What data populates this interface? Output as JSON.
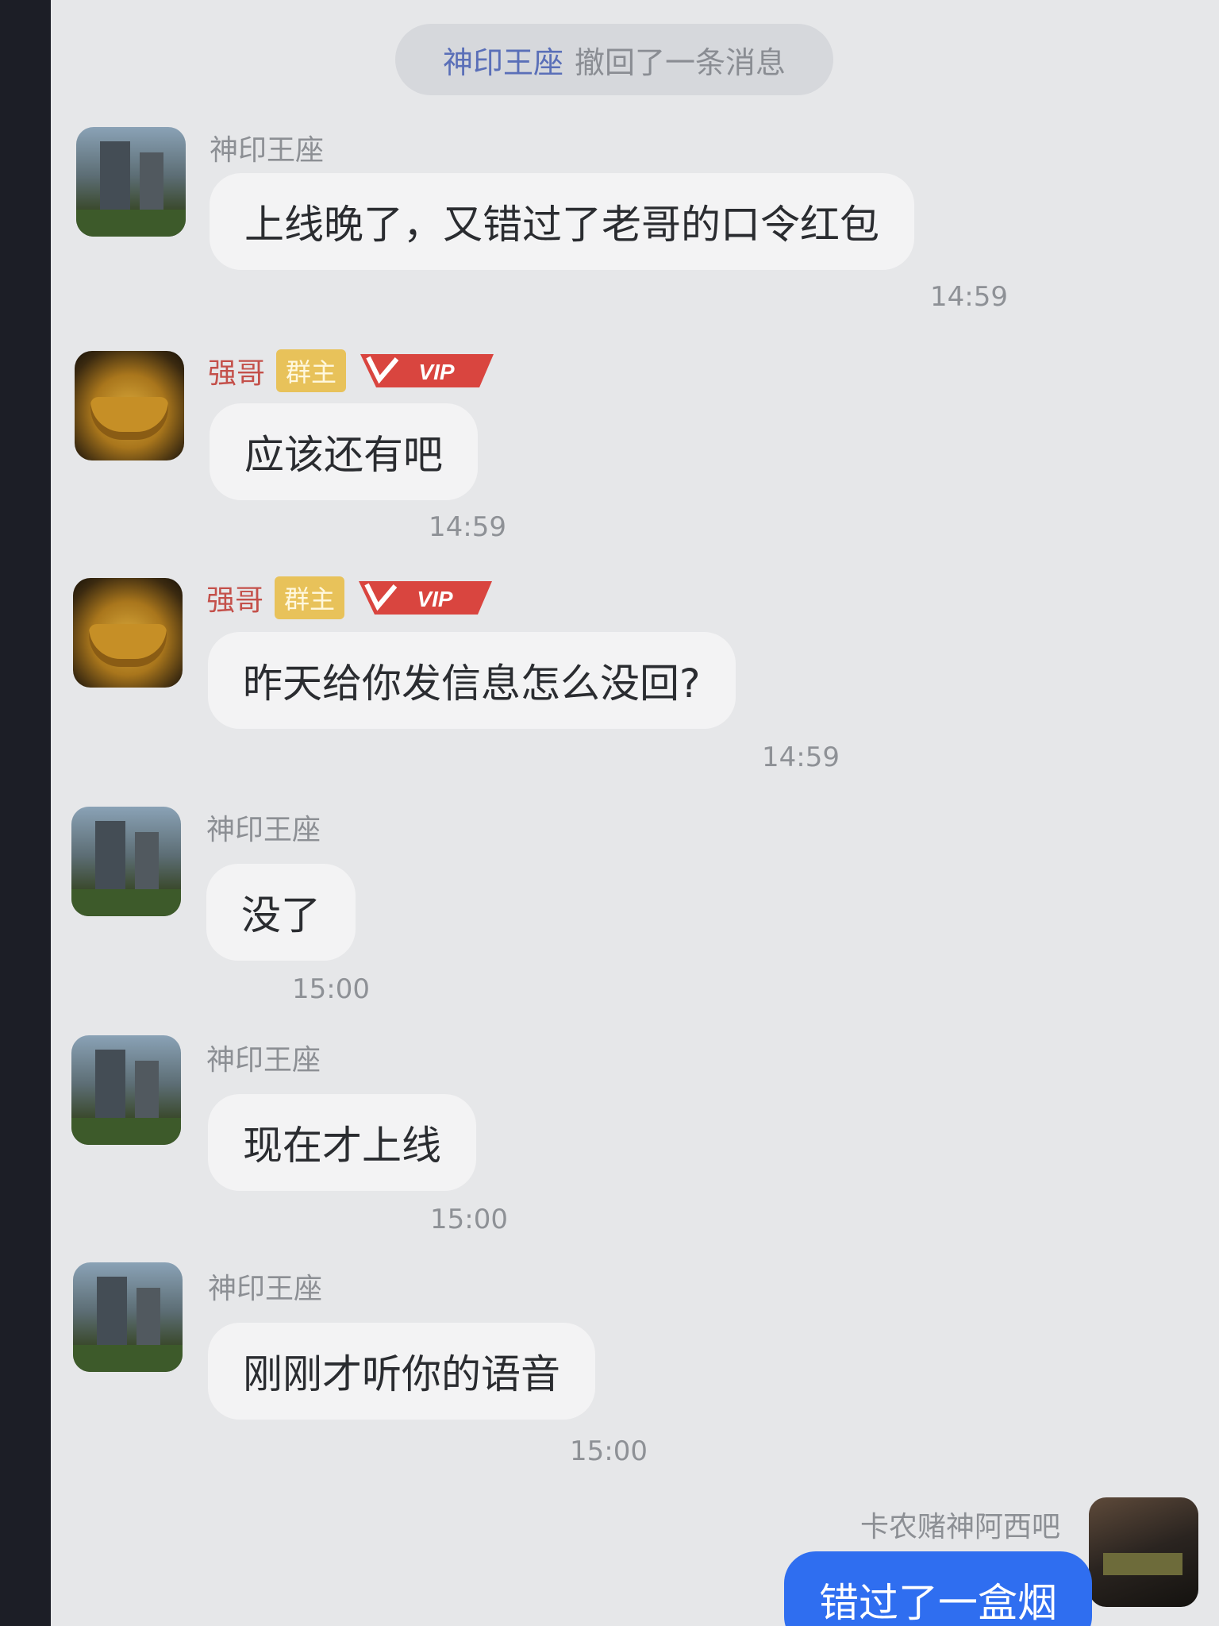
{
  "system_notice": {
    "actor": "神印王座",
    "text": "撤回了一条消息"
  },
  "badges": {
    "owner": "群主",
    "vip": "VIP"
  },
  "messages": [
    {
      "sender": "神印王座",
      "avatar": "building-avatar",
      "text": "上线晚了，又错过了老哥的口令红包",
      "time": "14:59"
    },
    {
      "sender": "强哥",
      "avatar": "treasure-pot-avatar",
      "is_owner": true,
      "is_vip": true,
      "text": "应该还有吧",
      "time": "14:59"
    },
    {
      "sender": "强哥",
      "avatar": "treasure-pot-avatar",
      "is_owner": true,
      "is_vip": true,
      "text": "昨天给你发信息怎么没回?",
      "time": "14:59"
    },
    {
      "sender": "神印王座",
      "avatar": "building-avatar",
      "text": "没了",
      "time": "15:00"
    },
    {
      "sender": "神印王座",
      "avatar": "building-avatar",
      "text": "现在才上线",
      "time": "15:00"
    },
    {
      "sender": "神印王座",
      "avatar": "building-avatar",
      "text": "刚刚才听你的语音",
      "time": "15:00"
    }
  ],
  "my_message": {
    "sender": "卡农赌神阿西吧",
    "avatar": "dark-avatar",
    "text": "错过了一盒烟"
  },
  "colors": {
    "background": "#e6e7e9",
    "bubble": "#f3f3f4",
    "my_bubble": "#2f6ef0",
    "owner_name": "#c4504a",
    "owner_badge": "#e8c25a",
    "vip_badge": "#d9453f",
    "notice_actor": "#5a6fb8"
  }
}
